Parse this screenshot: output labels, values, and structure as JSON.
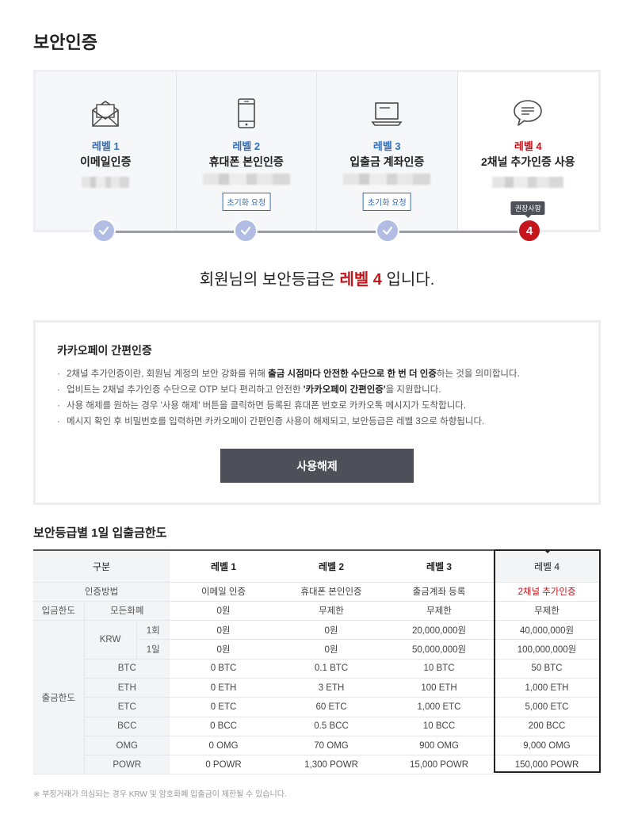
{
  "page_title": "보안인증",
  "levels": [
    {
      "num": "레벨 1",
      "name": "이메일인증",
      "reset": ""
    },
    {
      "num": "레벨 2",
      "name": "휴대폰 본인인증",
      "reset": "초기화 요청"
    },
    {
      "num": "레벨 3",
      "name": "입출금 계좌인증",
      "reset": "초기화 요청"
    },
    {
      "num": "레벨 4",
      "name": "2채널 추가인증 사용",
      "reset": ""
    }
  ],
  "recommend_tip": "권장사항",
  "active_step": "4",
  "status": {
    "prefix": "회원님의 보안등급은",
    "level": "레벨 4",
    "suffix": "입니다."
  },
  "kakao": {
    "title": "카카오페이 간편인증",
    "line1_a": "2채널 추가인증이란, 회원님 계정의 보안 강화를 위해 ",
    "line1_b": "출금 시점마다 안전한 수단으로 한 번 더 인증",
    "line1_c": "하는 것을 의미합니다.",
    "line2_a": "업비트는 2채널 추가인증 수단으로 OTP 보다 편리하고 안전한 ",
    "line2_b": "'카카오페이 간편인증'",
    "line2_c": "을 지원합니다.",
    "line3": "사용 해제를 원하는 경우 '사용 해제' 버튼을 클릭하면 등록된 휴대폰 번호로 카카오톡 메시지가 도착합니다.",
    "line4": "메시지 확인 후 비밀번호를 입력하면 카카오페이 간편인증 사용이 해제되고, 보안등급은 레벨 3으로 하향됩니다.",
    "button": "사용해제"
  },
  "limit_title": "보안등급별 1일 입출금한도",
  "table": {
    "header": [
      "구분",
      "레벨 1",
      "레벨 2",
      "레벨 3",
      "레벨 4"
    ],
    "auth_label": "인증방법",
    "auth": [
      "이메일 인증",
      "휴대폰 본인인증",
      "출금계좌 등록",
      "2채널 추가인증"
    ],
    "deposit_label": "입금한도",
    "deposit_sub": "모든화폐",
    "deposit": [
      "0원",
      "무제한",
      "무제한",
      "무제한"
    ],
    "withdraw_label": "출금한도",
    "krw_label": "KRW",
    "krw_once_label": "1회",
    "krw_once": [
      "0원",
      "0원",
      "20,000,000원",
      "40,000,000원"
    ],
    "krw_day_label": "1일",
    "krw_day": [
      "0원",
      "0원",
      "50,000,000원",
      "100,000,000원"
    ],
    "coins": [
      {
        "name": "BTC",
        "v": [
          "0 BTC",
          "0.1 BTC",
          "10 BTC",
          "50 BTC"
        ]
      },
      {
        "name": "ETH",
        "v": [
          "0 ETH",
          "3 ETH",
          "100 ETH",
          "1,000 ETH"
        ]
      },
      {
        "name": "ETC",
        "v": [
          "0 ETC",
          "60 ETC",
          "1,000 ETC",
          "5,000 ETC"
        ]
      },
      {
        "name": "BCC",
        "v": [
          "0 BCC",
          "0.5 BCC",
          "10 BCC",
          "200 BCC"
        ]
      },
      {
        "name": "OMG",
        "v": [
          "0 OMG",
          "70 OMG",
          "900 OMG",
          "9,000 OMG"
        ]
      },
      {
        "name": "POWR",
        "v": [
          "0 POWR",
          "1,300 POWR",
          "15,000 POWR",
          "150,000 POWR"
        ]
      }
    ]
  },
  "footnote": "※ 부정거래가 의심되는 경우 KRW 및 암호화폐 입출금이 제한될 수 있습니다.",
  "colors": {
    "accent_red": "#c4161c",
    "accent_blue": "#336fb9",
    "check": "#b2bde3",
    "button": "#4d5058"
  }
}
